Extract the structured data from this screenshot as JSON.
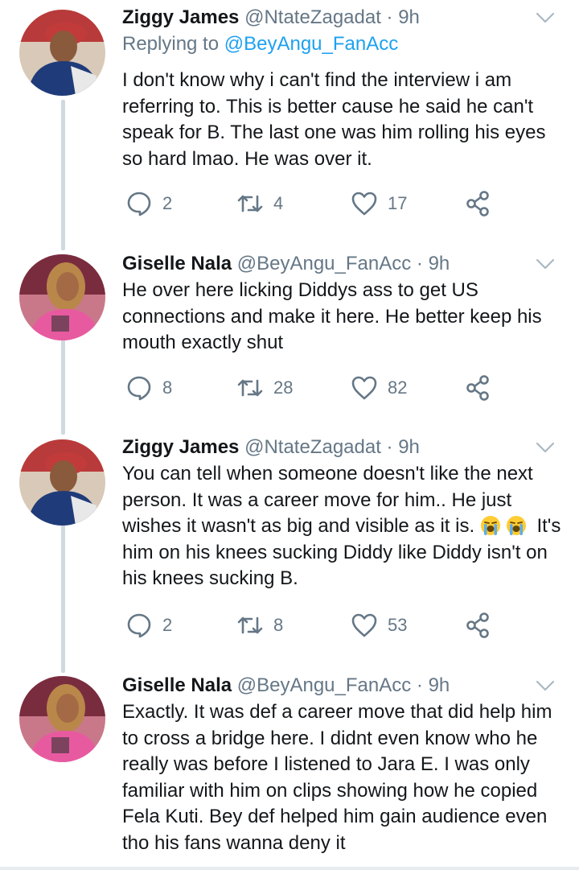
{
  "tweets": [
    {
      "name": "Ziggy James",
      "handle": "@NtateZagadat",
      "time": "· 9h",
      "reply_prefix": "Replying to ",
      "reply_to": "@BeyAngu_FanAcc",
      "text": "I don't know why i can't find the interview i am referring to. This is better cause he said he can't speak for B. The last one was him rolling his eyes so hard lmao. He was over it.",
      "replies": "2",
      "retweets": "4",
      "likes": "17"
    },
    {
      "name": "Giselle Nala",
      "handle": "@BeyAngu_FanAcc",
      "time": "· 9h",
      "text": "He over here licking Diddys ass to get US connections and make it here. He better keep his mouth exactly shut",
      "replies": "8",
      "retweets": "28",
      "likes": "82"
    },
    {
      "name": "Ziggy James",
      "handle": "@NtateZagadat",
      "time": "· 9h",
      "text_a": "You can tell when someone doesn't like the next person. It was a career move for him.. He just wishes it wasn't as big and visible as it is. ",
      "text_b": "It's him on his knees sucking Diddy like Diddy isn't on his knees sucking B.",
      "replies": "2",
      "retweets": "8",
      "likes": "53"
    },
    {
      "name": "Giselle Nala",
      "handle": "@BeyAngu_FanAcc",
      "time": "· 9h",
      "text": "Exactly. It was def a career move that did help him to cross a bridge here. I didnt even know who he really was before I listened to Jara E. I was only familiar with him on clips showing how he copied Fela Kuti. Bey def helped him gain audience even tho his fans wanna deny it"
    }
  ],
  "icons": {
    "reply": "reply-icon",
    "retweet": "retweet-icon",
    "like": "heart-icon",
    "share": "share-icon",
    "menu": "chevron-down-icon",
    "emoji": "loudly-crying-face-emoji"
  },
  "colors": {
    "link": "#1da1f2",
    "secondary_text": "#657786",
    "thread_line": "#cfd9de"
  }
}
